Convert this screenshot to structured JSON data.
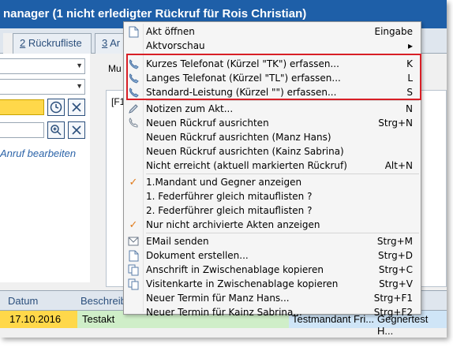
{
  "window": {
    "title": "nanager (1 nicht erledigter Rückruf für Rois Christian)"
  },
  "tabs": [
    {
      "prefix": "",
      "acc": "2",
      "rest": " Rückrufliste"
    },
    {
      "prefix": "",
      "acc": "3",
      "rest": " Ar"
    }
  ],
  "left": {
    "anruf_link": "Anruf bearbeiten"
  },
  "right": {
    "mu_label": "Mu",
    "f1_label": "[F1"
  },
  "grid": {
    "headers": {
      "datum": "Datum",
      "beschreibung": "Beschreib"
    },
    "row": {
      "datum": "17.10.2016",
      "beschreibung": "Testakt",
      "mandant": "Testmandant Fri...",
      "gegner": "Gegnertest H..."
    }
  },
  "menu": {
    "items": [
      {
        "label": "Akt öffnen",
        "shortcut": "Eingabe",
        "icon": "document-icon"
      },
      {
        "label": "Aktvorschau",
        "shortcut": "",
        "submenu": "▸"
      },
      {
        "label": "Kurzes Telefonat (Kürzel \"TK\") erfassen...",
        "shortcut": "K",
        "icon": "phone-icon"
      },
      {
        "label": "Langes Telefonat (Kürzel \"TL\") erfassen...",
        "shortcut": "L",
        "icon": "phone-icon"
      },
      {
        "label": "Standard-Leistung (Kürzel \"\") erfassen...",
        "shortcut": "S",
        "icon": "phone-icon"
      },
      {
        "label": "Notizen zum Akt...",
        "shortcut": "N",
        "icon": "pencil-icon"
      },
      {
        "label": "Neuen Rückruf ausrichten",
        "shortcut": "Strg+N",
        "icon": "handset-icon"
      },
      {
        "label": "Neuen Rückruf ausrichten (Manz Hans)",
        "shortcut": ""
      },
      {
        "label": "Neuen Rückruf ausrichten (Kainz Sabrina)",
        "shortcut": ""
      },
      {
        "label": "Nicht erreicht (aktuell markierten Rückruf)",
        "shortcut": "Alt+N"
      },
      {
        "label": "1.Mandant und Gegner anzeigen",
        "shortcut": "",
        "checked": "✓"
      },
      {
        "label": "1. Federführer gleich mitauflisten ?",
        "shortcut": ""
      },
      {
        "label": "2. Federführer gleich mitauflisten ?",
        "shortcut": ""
      },
      {
        "label": "Nur nicht archivierte Akten anzeigen",
        "shortcut": "",
        "checked": "✓"
      },
      {
        "label": "EMail senden",
        "shortcut": "Strg+M",
        "icon": "mail-icon"
      },
      {
        "label": "Dokument erstellen...",
        "shortcut": "Strg+D",
        "icon": "document-icon"
      },
      {
        "label": "Anschrift in Zwischenablage kopieren",
        "shortcut": "Strg+C",
        "icon": "copy-icon"
      },
      {
        "label": "Visitenkarte in Zwischenablage kopieren",
        "shortcut": "Strg+V",
        "icon": "copy-icon"
      },
      {
        "label": "Neuer Termin für Manz Hans...",
        "shortcut": "Strg+F1"
      },
      {
        "label": "Neuer Termin für Kainz Sabrina...",
        "shortcut": "Strg+F2"
      }
    ]
  },
  "colors": {
    "titlebar": "#1e5fa8",
    "highlight": "#d81f26",
    "yellow": "#ffd84a",
    "check": "#e07a1a"
  }
}
